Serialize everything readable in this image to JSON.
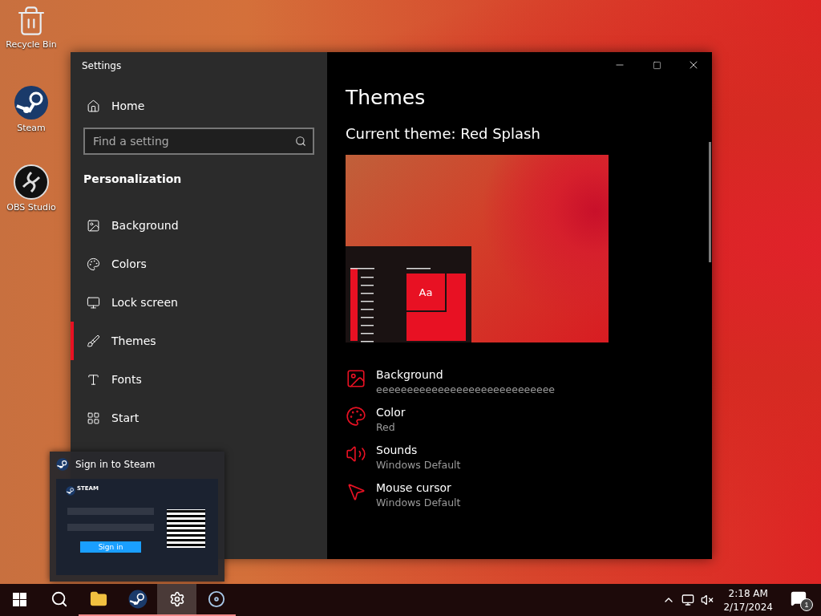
{
  "desktop_icons": [
    {
      "kind": "recycle",
      "label": "Recycle Bin"
    },
    {
      "kind": "steam",
      "label": "Steam"
    },
    {
      "kind": "obs",
      "label": "OBS Studio"
    }
  ],
  "window": {
    "title": "Settings"
  },
  "sidebar": {
    "home": "Home",
    "search": {
      "placeholder": "Find a setting"
    },
    "section": "Personalization",
    "items": [
      {
        "kind": "background",
        "label": "Background",
        "selected": false
      },
      {
        "kind": "colors",
        "label": "Colors",
        "selected": false
      },
      {
        "kind": "lock",
        "label": "Lock screen",
        "selected": false
      },
      {
        "kind": "themes",
        "label": "Themes",
        "selected": true
      },
      {
        "kind": "fonts",
        "label": "Fonts",
        "selected": false
      },
      {
        "kind": "start",
        "label": "Start",
        "selected": false
      }
    ]
  },
  "content": {
    "title": "Themes",
    "current_theme": "Current theme: Red Splash",
    "preview_tile": "Aa",
    "settings": [
      {
        "kind": "background",
        "label": "Background",
        "value": "eeeeeeeeeeeeeeeeeeeeeeeeeeeee"
      },
      {
        "kind": "color",
        "label": "Color",
        "value": "Red"
      },
      {
        "kind": "sounds",
        "label": "Sounds",
        "value": "Windows Default"
      },
      {
        "kind": "cursor",
        "label": "Mouse cursor",
        "value": "Windows Default"
      }
    ]
  },
  "thumbnail": {
    "title": "Sign in to Steam",
    "brand": "STEAM",
    "button": "Sign in"
  },
  "taskbar": {
    "apps": [
      {
        "kind": "start",
        "running": false,
        "selected": false
      },
      {
        "kind": "search",
        "running": false,
        "selected": false
      },
      {
        "kind": "explorer",
        "running": true,
        "selected": false
      },
      {
        "kind": "steam",
        "running": true,
        "selected": false
      },
      {
        "kind": "settings",
        "running": true,
        "selected": true
      },
      {
        "kind": "installer",
        "running": true,
        "selected": false
      }
    ],
    "time": "2:18 AM",
    "date": "2/17/2024",
    "notifications": "1"
  }
}
